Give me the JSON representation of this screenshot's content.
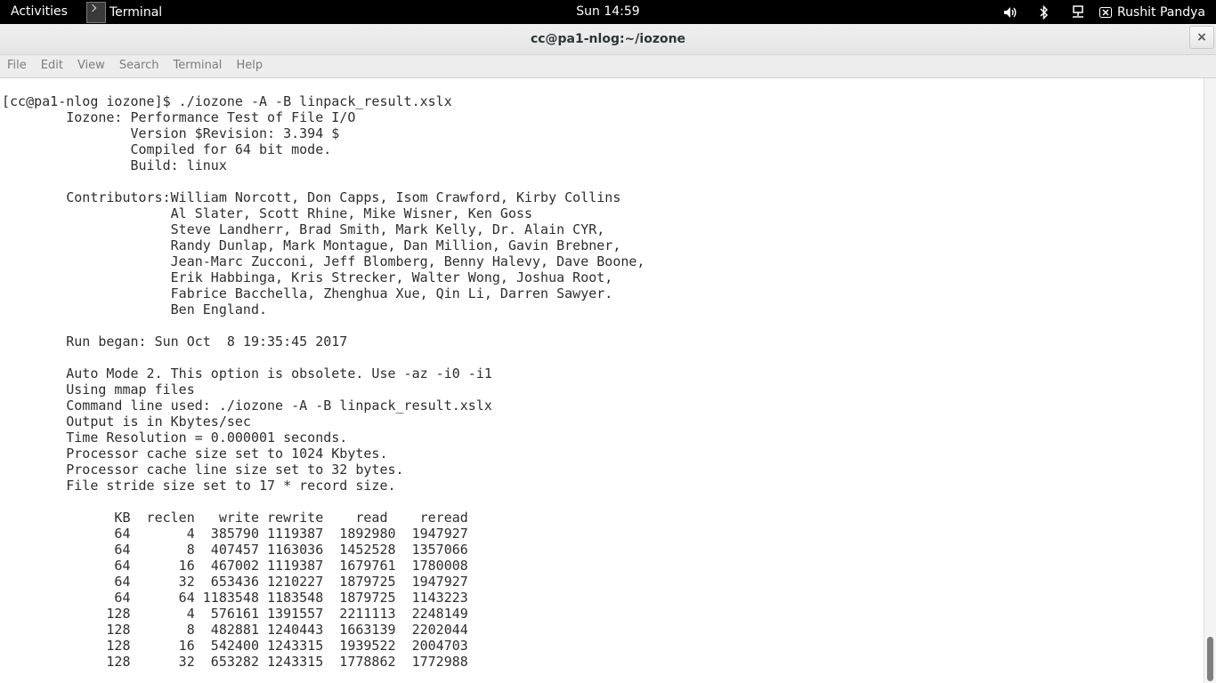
{
  "topbar": {
    "activities": "Activities",
    "app_name": "Terminal",
    "clock": "Sun 14:59",
    "user_name": "Rushit Pandya",
    "icons": [
      "volume-icon",
      "bluetooth-icon",
      "network-icon",
      "user-icon"
    ]
  },
  "window": {
    "title": "cc@pa1-nlog:~/iozone",
    "close_label": "×"
  },
  "menubar": {
    "items": [
      "File",
      "Edit",
      "View",
      "Search",
      "Terminal",
      "Help"
    ]
  },
  "terminal": {
    "lines": [
      "[cc@pa1-nlog iozone]$ ./iozone -A -B linpack_result.xslx",
      "        Iozone: Performance Test of File I/O",
      "                Version $Revision: 3.394 $",
      "                Compiled for 64 bit mode.",
      "                Build: linux",
      "",
      "        Contributors:William Norcott, Don Capps, Isom Crawford, Kirby Collins",
      "                     Al Slater, Scott Rhine, Mike Wisner, Ken Goss",
      "                     Steve Landherr, Brad Smith, Mark Kelly, Dr. Alain CYR,",
      "                     Randy Dunlap, Mark Montague, Dan Million, Gavin Brebner,",
      "                     Jean-Marc Zucconi, Jeff Blomberg, Benny Halevy, Dave Boone,",
      "                     Erik Habbinga, Kris Strecker, Walter Wong, Joshua Root,",
      "                     Fabrice Bacchella, Zhenghua Xue, Qin Li, Darren Sawyer.",
      "                     Ben England.",
      "",
      "        Run began: Sun Oct  8 19:35:45 2017",
      "",
      "        Auto Mode 2. This option is obsolete. Use -az -i0 -i1",
      "        Using mmap files",
      "        Command line used: ./iozone -A -B linpack_result.xslx",
      "        Output is in Kbytes/sec",
      "        Time Resolution = 0.000001 seconds.",
      "        Processor cache size set to 1024 Kbytes.",
      "        Processor cache line size set to 32 bytes.",
      "        File stride size set to 17 * record size.",
      "",
      "              KB  reclen   write rewrite    read    reread",
      "              64       4  385790 1119387  1892980  1947927",
      "              64       8  407457 1163036  1452528  1357066",
      "              64      16  467002 1119387  1679761  1780008",
      "              64      32  653436 1210227  1879725  1947927",
      "              64      64 1183548 1183548  1879725  1143223",
      "             128       4  576161 1391557  2211113  2248149",
      "             128       8  482881 1240443  1663139  2202044",
      "             128      16  542400 1243315  1939522  2004703",
      "             128      32  653282 1243315  1778862  1772988"
    ]
  }
}
